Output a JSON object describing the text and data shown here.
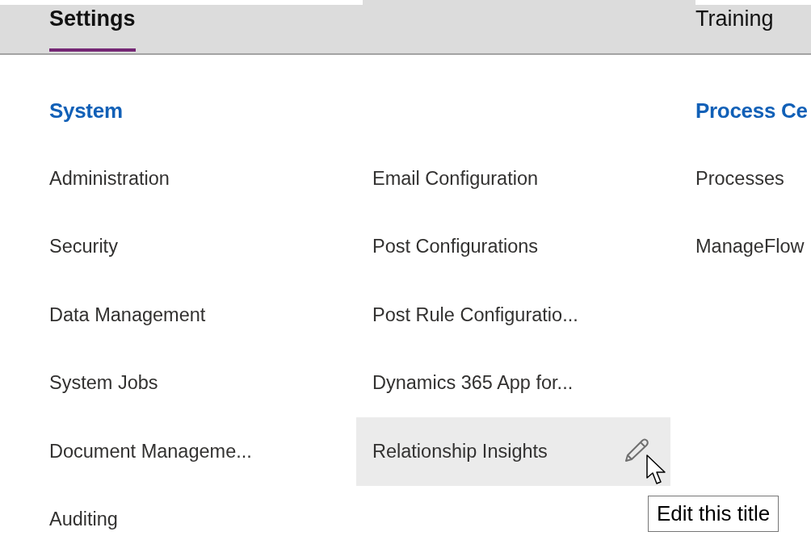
{
  "tabs": [
    {
      "label": "Settings",
      "selected": true
    },
    {
      "label": "Training",
      "selected": false
    }
  ],
  "columns": [
    {
      "heading": "System",
      "items": [
        {
          "label": "Administration",
          "hovered": false
        },
        {
          "label": "Security",
          "hovered": false
        },
        {
          "label": "Data Management",
          "hovered": false
        },
        {
          "label": "System Jobs",
          "hovered": false
        },
        {
          "label": "Document Manageme...",
          "hovered": false
        },
        {
          "label": "Auditing",
          "hovered": false
        }
      ]
    },
    {
      "items": [
        {
          "label": "Email Configuration",
          "hovered": false
        },
        {
          "label": "Post Configurations",
          "hovered": false
        },
        {
          "label": "Post Rule Configuratio...",
          "hovered": false
        },
        {
          "label": "Dynamics 365 App for...",
          "hovered": false
        },
        {
          "label": "Relationship Insights",
          "hovered": true,
          "tooltip": "Edit this title"
        }
      ]
    },
    {
      "heading": "Process Ce",
      "items": [
        {
          "label": "Processes",
          "hovered": false
        },
        {
          "label": "ManageFlow",
          "hovered": false
        }
      ]
    }
  ]
}
